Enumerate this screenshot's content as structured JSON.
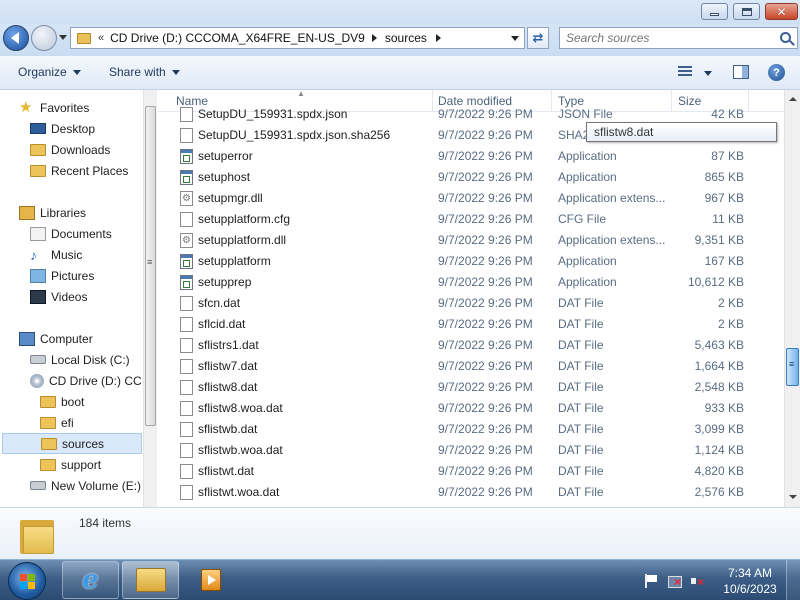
{
  "window": {
    "address": {
      "chevron": "«",
      "segments": [
        "CD Drive (D:) CCCOMA_X64FRE_EN-US_DV9",
        "sources"
      ]
    },
    "search": {
      "placeholder": "Search sources"
    }
  },
  "toolbar": {
    "organize": "Organize",
    "share_with": "Share with",
    "help": "?"
  },
  "nav": {
    "favorites": "Favorites",
    "desktop": "Desktop",
    "downloads": "Downloads",
    "recent_places": "Recent Places",
    "libraries": "Libraries",
    "documents": "Documents",
    "music": "Music",
    "pictures": "Pictures",
    "videos": "Videos",
    "computer": "Computer",
    "local_disk": "Local Disk (C:)",
    "cd_drive": "CD Drive (D:) CC",
    "boot": "boot",
    "efi": "efi",
    "sources": "sources",
    "support": "support",
    "new_volume": "New Volume (E:)"
  },
  "columns": {
    "name": "Name",
    "date_modified": "Date modified",
    "type": "Type",
    "size": "Size"
  },
  "files": [
    {
      "name": "SetupDU_159931.spdx.json",
      "date": "9/7/2022 9:26 PM",
      "type": "JSON File",
      "size": "42 KB",
      "icon": "file-icon"
    },
    {
      "name": "SetupDU_159931.spdx.json.sha256",
      "date": "9/7/2022 9:26 PM",
      "type": "SHA2",
      "size": "",
      "icon": "file-icon"
    },
    {
      "name": "setuperror",
      "date": "9/7/2022 9:26 PM",
      "type": "Application",
      "size": "87 KB",
      "icon": "app-icon"
    },
    {
      "name": "setuphost",
      "date": "9/7/2022 9:26 PM",
      "type": "Application",
      "size": "865 KB",
      "icon": "app-icon"
    },
    {
      "name": "setupmgr.dll",
      "date": "9/7/2022 9:26 PM",
      "type": "Application extens...",
      "size": "967 KB",
      "icon": "dll-icon"
    },
    {
      "name": "setupplatform.cfg",
      "date": "9/7/2022 9:26 PM",
      "type": "CFG File",
      "size": "11 KB",
      "icon": "file-icon"
    },
    {
      "name": "setupplatform.dll",
      "date": "9/7/2022 9:26 PM",
      "type": "Application extens...",
      "size": "9,351 KB",
      "icon": "dll-icon"
    },
    {
      "name": "setupplatform",
      "date": "9/7/2022 9:26 PM",
      "type": "Application",
      "size": "167 KB",
      "icon": "app-icon"
    },
    {
      "name": "setupprep",
      "date": "9/7/2022 9:26 PM",
      "type": "Application",
      "size": "10,612 KB",
      "icon": "app-icon"
    },
    {
      "name": "sfcn.dat",
      "date": "9/7/2022 9:26 PM",
      "type": "DAT File",
      "size": "2 KB",
      "icon": "file-icon"
    },
    {
      "name": "sflcid.dat",
      "date": "9/7/2022 9:26 PM",
      "type": "DAT File",
      "size": "2 KB",
      "icon": "file-icon"
    },
    {
      "name": "sflistrs1.dat",
      "date": "9/7/2022 9:26 PM",
      "type": "DAT File",
      "size": "5,463 KB",
      "icon": "file-icon"
    },
    {
      "name": "sflistw7.dat",
      "date": "9/7/2022 9:26 PM",
      "type": "DAT File",
      "size": "1,664 KB",
      "icon": "file-icon"
    },
    {
      "name": "sflistw8.dat",
      "date": "9/7/2022 9:26 PM",
      "type": "DAT File",
      "size": "2,548 KB",
      "icon": "file-icon"
    },
    {
      "name": "sflistw8.woa.dat",
      "date": "9/7/2022 9:26 PM",
      "type": "DAT File",
      "size": "933 KB",
      "icon": "file-icon"
    },
    {
      "name": "sflistwb.dat",
      "date": "9/7/2022 9:26 PM",
      "type": "DAT File",
      "size": "3,099 KB",
      "icon": "file-icon"
    },
    {
      "name": "sflistwb.woa.dat",
      "date": "9/7/2022 9:26 PM",
      "type": "DAT File",
      "size": "1,124 KB",
      "icon": "file-icon"
    },
    {
      "name": "sflistwt.dat",
      "date": "9/7/2022 9:26 PM",
      "type": "DAT File",
      "size": "4,820 KB",
      "icon": "file-icon"
    },
    {
      "name": "sflistwt.woa.dat",
      "date": "9/7/2022 9:26 PM",
      "type": "DAT File",
      "size": "2,576 KB",
      "icon": "file-icon"
    }
  ],
  "tooltip": {
    "text": "sflistw8.dat"
  },
  "details": {
    "item_count": "184 items"
  },
  "taskbar": {
    "time": "7:34 AM",
    "date": "10/6/2023"
  }
}
